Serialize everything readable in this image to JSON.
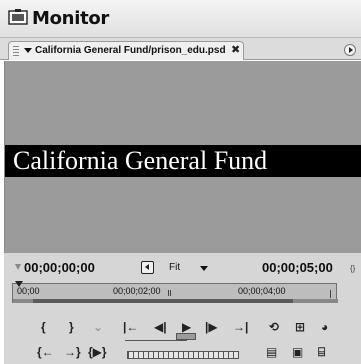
{
  "window": {
    "title": "Monitor",
    "icon": "monitor-app-icon"
  },
  "tab": {
    "label": "California General Fund/prison_edu.psd",
    "close_label": "✖",
    "menu_icon": "panel-menu-icon"
  },
  "viewer": {
    "frame_text": "California General Fund"
  },
  "controls": {
    "timecode_in": "00;00;00;00",
    "zoom_level": "Fit",
    "duration": "00;00;05;00",
    "duration_icon": "{}"
  },
  "ruler": {
    "labels": [
      "00;00",
      "00;00;02;00",
      "00;00;04;00"
    ]
  },
  "buttons": {
    "mark_in": "{",
    "mark_out": "}",
    "set_unnumbered_marker": "⌄",
    "go_to_in": "{←",
    "go_to_out": "→}",
    "play_in_to_out": "{▶}",
    "go_to_in_point": "|←",
    "step_back": "◀|",
    "play": "▶",
    "step_forward": "|▶",
    "go_to_out_point": "→|",
    "loop": "⟲",
    "safe_margins": "⊞",
    "output": "◕",
    "insert": "▤",
    "overlay": "▣",
    "export_frame": "⌸"
  }
}
